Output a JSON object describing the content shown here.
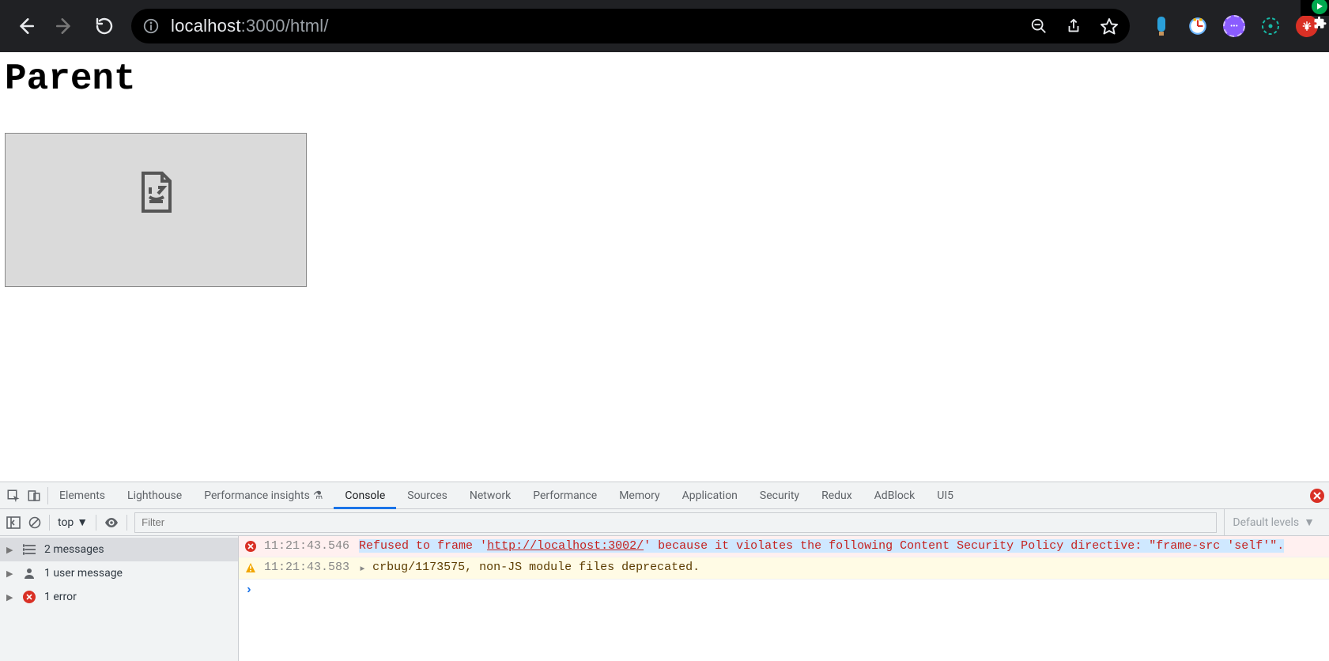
{
  "browser": {
    "url_prefix": "localhost",
    "url_suffix": ":3000/html/"
  },
  "page": {
    "heading": "Parent"
  },
  "devtools": {
    "tabs": [
      "Elements",
      "Lighthouse",
      "Performance insights",
      "Console",
      "Sources",
      "Network",
      "Performance",
      "Memory",
      "Application",
      "Security",
      "Redux",
      "AdBlock",
      "UI5"
    ],
    "active_tab": "Console",
    "context_label": "top",
    "filter_placeholder": "Filter",
    "levels_label": "Default levels",
    "sidebar": [
      {
        "label": "2 messages",
        "icon": "list",
        "selected": true
      },
      {
        "label": "1 user message",
        "icon": "user",
        "selected": false
      },
      {
        "label": "1 error",
        "icon": "error",
        "selected": false
      }
    ],
    "messages": [
      {
        "kind": "error",
        "ts": "11:21:43.546",
        "pre": "Refused to frame '",
        "link": "http://localhost:3002/",
        "post": "' because it violates the following Content Security Policy directive: \"frame-src 'self'\"."
      },
      {
        "kind": "warning",
        "ts": "11:21:43.583",
        "text": "crbug/1173575, non-JS module files deprecated."
      }
    ]
  }
}
